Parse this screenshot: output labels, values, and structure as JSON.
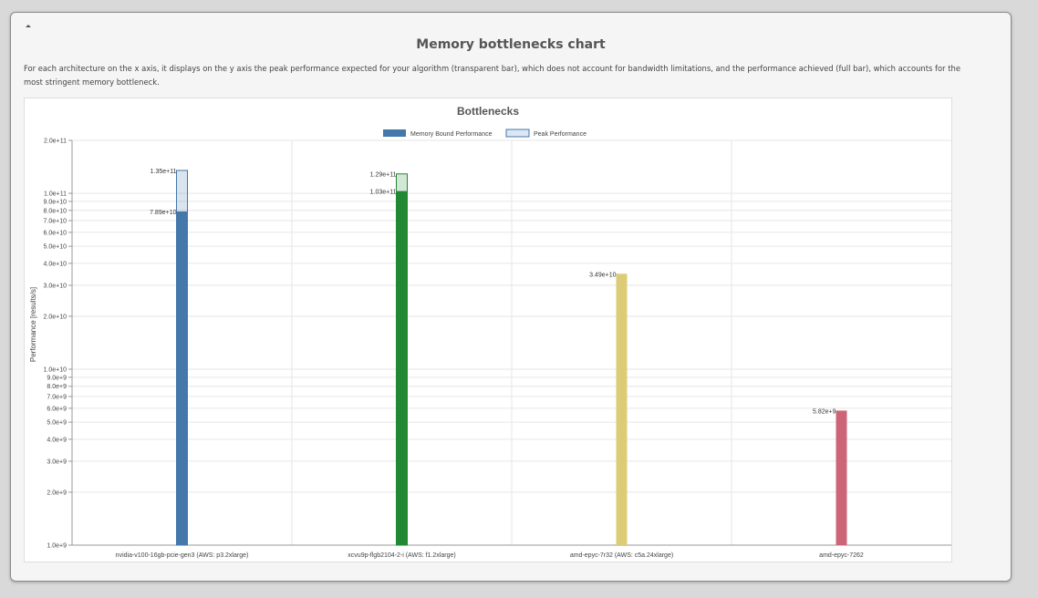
{
  "panel": {
    "title": "Memory bottlenecks chart",
    "description": "For each architecture on the x axis, it displays on the y axis the peak performance expected for your algorithm (transparent bar), which does not account for bandwidth limitations, and the performance achieved (full bar), which accounts for the most stringent memory bottleneck.",
    "toggle_icon": "collapse-triangle-icon"
  },
  "chart_data": {
    "type": "bar",
    "title": "Bottlenecks",
    "ylabel": "Performance [results/s]",
    "xlabel": "",
    "yscale": "log",
    "ylim": [
      1000000000,
      200000000000
    ],
    "grid": true,
    "legend_position": "top-center",
    "legend": [
      {
        "label": "Memory Bound Performance",
        "style": "filled"
      },
      {
        "label": "Peak Performance",
        "style": "transparent"
      }
    ],
    "y_ticks": [
      {
        "value": 1000000000,
        "label": "1.0e+9"
      },
      {
        "value": 2000000000,
        "label": "2.0e+9"
      },
      {
        "value": 3000000000,
        "label": "3.0e+9"
      },
      {
        "value": 4000000000,
        "label": "4.0e+9"
      },
      {
        "value": 5000000000,
        "label": "5.0e+9"
      },
      {
        "value": 6000000000,
        "label": "6.0e+9"
      },
      {
        "value": 7000000000,
        "label": "7.0e+9"
      },
      {
        "value": 8000000000,
        "label": "8.0e+9"
      },
      {
        "value": 9000000000,
        "label": "9.0e+9"
      },
      {
        "value": 10000000000,
        "label": "1.0e+10"
      },
      {
        "value": 20000000000,
        "label": "2.0e+10"
      },
      {
        "value": 30000000000,
        "label": "3.0e+10"
      },
      {
        "value": 40000000000,
        "label": "4.0e+10"
      },
      {
        "value": 50000000000,
        "label": "5.0e+10"
      },
      {
        "value": 60000000000,
        "label": "6.0e+10"
      },
      {
        "value": 70000000000,
        "label": "7.0e+10"
      },
      {
        "value": 80000000000,
        "label": "8.0e+10"
      },
      {
        "value": 90000000000,
        "label": "9.0e+10"
      },
      {
        "value": 100000000000,
        "label": "1.0e+11"
      },
      {
        "value": 200000000000,
        "label": "2.0e+11"
      }
    ],
    "categories": [
      "nvidia-v100-16gb-pcie-gen3 (AWS: p3.2xlarge)",
      "xcvu9p-flgb2104-2-i (AWS: f1.2xlarge)",
      "amd-epyc-7r32 (AWS: c5a.24xlarge)",
      "amd-epyc-7262"
    ],
    "bars": [
      {
        "memory_bound": 78900000000,
        "memory_bound_label": "7.89e+10",
        "peak": 135000000000,
        "peak_label": "1.35e+11",
        "color": "#4477aa"
      },
      {
        "memory_bound": 103000000000,
        "memory_bound_label": "1.03e+11",
        "peak": 129000000000,
        "peak_label": "1.29e+11",
        "color": "#228833"
      },
      {
        "memory_bound": 34900000000,
        "memory_bound_label": "3.49e+10",
        "peak": 34900000000,
        "peak_label": "",
        "color": "#ddcc77"
      },
      {
        "memory_bound": 5820000000,
        "memory_bound_label": "5.82e+9",
        "peak": 5820000000,
        "peak_label": "",
        "color": "#cc6677"
      }
    ],
    "legend_colors": {
      "filled": "#4477aa",
      "transparent_fill": "#dbe7f5",
      "transparent_stroke": "#4477aa"
    }
  }
}
